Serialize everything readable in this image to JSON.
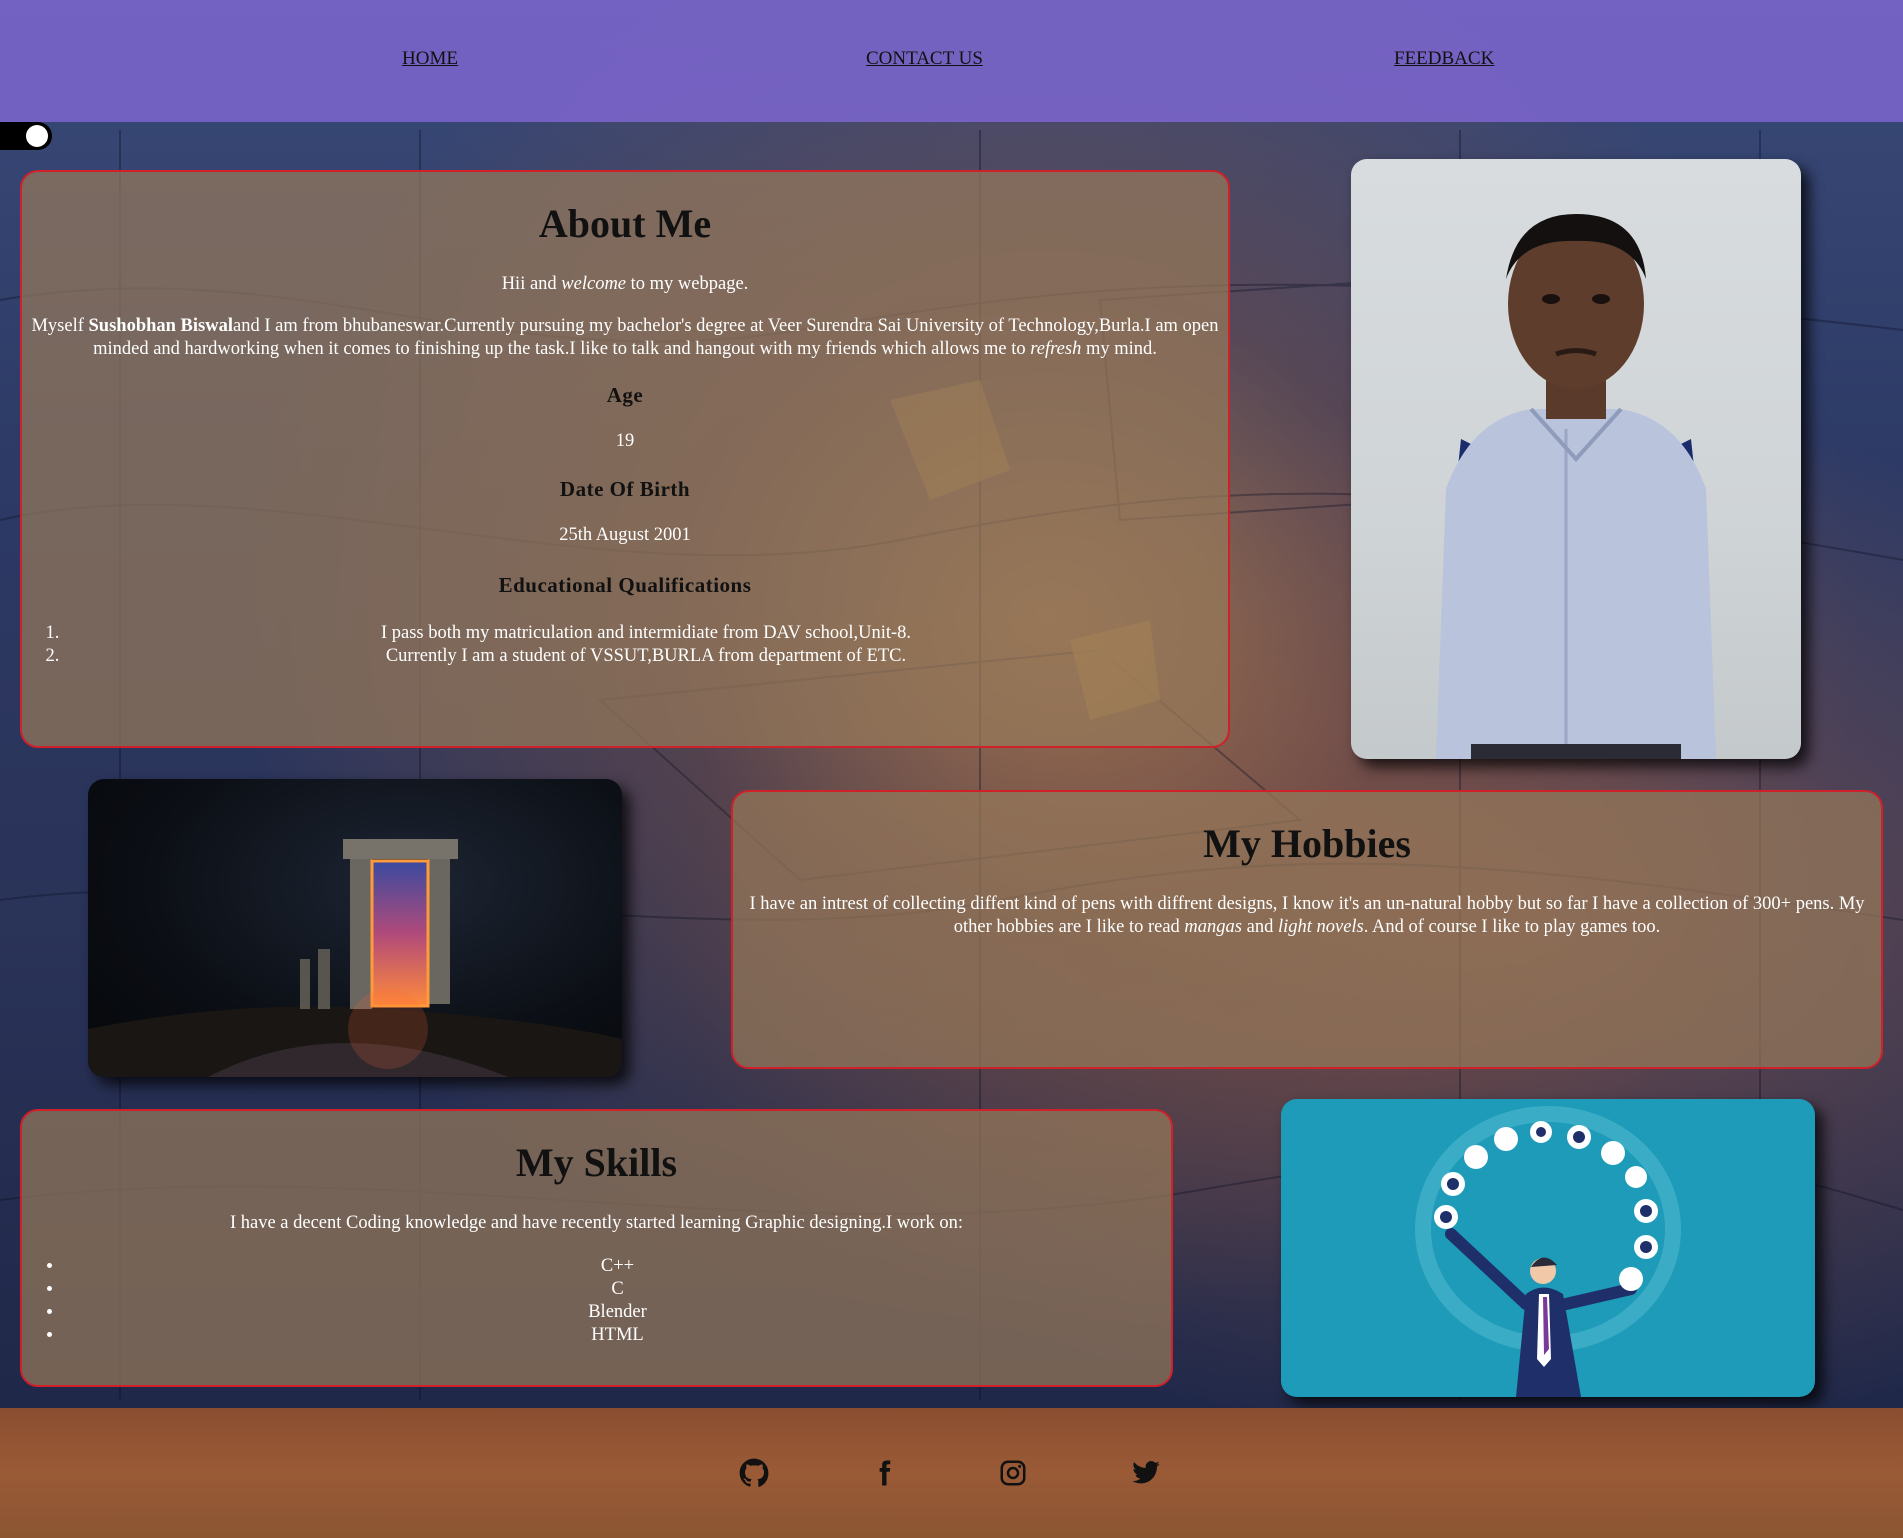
{
  "nav": {
    "home": "HOME",
    "contact": "CONTACT US",
    "feedback": "FEEDBACK"
  },
  "theme_toggle": {
    "state": "on"
  },
  "about": {
    "title": "About Me",
    "greeting_pre": "Hii and ",
    "greeting_em": "welcome",
    "greeting_post": " to my webpage.",
    "intro_pre": "Myself ",
    "intro_name": "Sushobhan Biswal",
    "intro_text": "and I am from bhubaneswar.Currently pursuing my bachelor's degree at Veer Surendra Sai University of Technology,Burla.I am open minded and hardworking when it comes to finishing up the task.I like to talk and hangout with my friends which allows me to ",
    "intro_em": "refresh",
    "intro_end": " my mind.",
    "age_heading": "Age",
    "age_value": "19",
    "dob_heading": "Date Of Birth",
    "dob_value": "25th August 2001",
    "edu_heading": "Educational Qualifications",
    "edu_items": [
      "I pass both my matriculation and intermidiate from DAV school,Unit-8.",
      "Currently I am a student of VSSUT,BURLA from department of ETC."
    ]
  },
  "hobbies": {
    "title": "My Hobbies",
    "text_pre": "I have an intrest of collecting diffent kind of pens with diffrent designs, I know it's an un-natural hobby but so far I have a collection of 300+ pens. My other hobbies are I like to read ",
    "em1": "mangas",
    "mid": " and ",
    "em2": "light novels",
    "text_end": ". And of course I like to play games too."
  },
  "skills": {
    "title": "My Skills",
    "intro": "I have a decent Coding knowledge and have recently started learning Graphic designing.I work on:",
    "items": [
      "C++",
      "C",
      "Blender",
      "HTML"
    ]
  },
  "footer": {
    "icons": [
      "github-icon",
      "facebook-icon",
      "instagram-icon",
      "twitter-icon"
    ]
  },
  "colors": {
    "nav_bg": "#7864c8",
    "card_border": "#d0202a",
    "card_bg": "#96785a",
    "footer_bg": "#8a4e30",
    "skills_image_bg": "#1d9bb8"
  }
}
